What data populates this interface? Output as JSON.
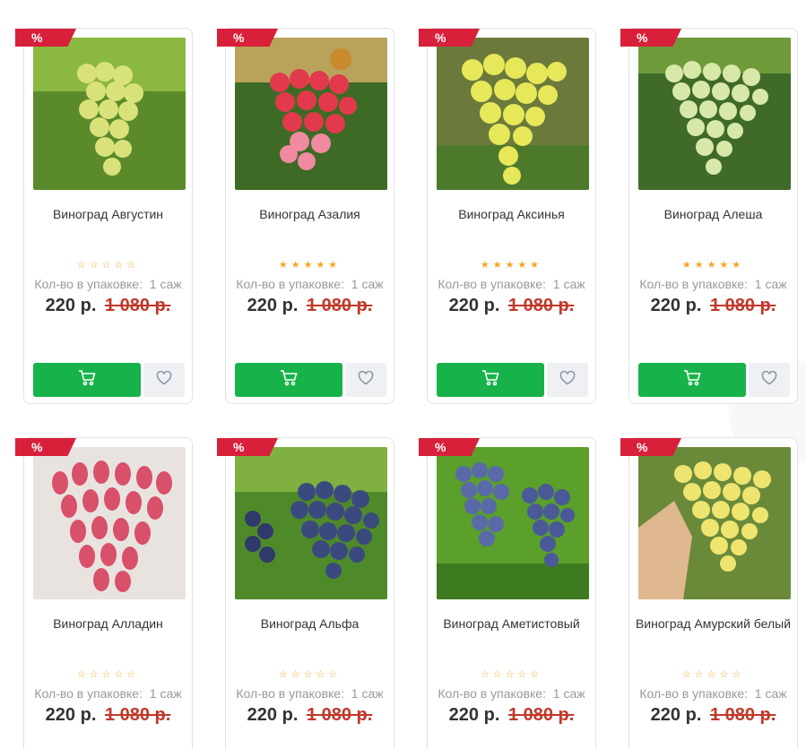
{
  "badge_label": "%",
  "qty_label": "Кол-во в упаковке:",
  "qty_value": "1 саж",
  "colors": {
    "cart": "#17b34a",
    "badge": "#d8203a",
    "old_price": "#c0392b",
    "star": "#f5a623"
  },
  "icons": {
    "cart": "cart-icon",
    "favorite": "heart-icon"
  },
  "products": [
    {
      "title": "Виноград Августин",
      "price": "220 р.",
      "old_price": "1 080 р.",
      "rating": 0,
      "stars": "☆☆☆☆☆"
    },
    {
      "title": "Виноград Азалия",
      "price": "220 р.",
      "old_price": "1 080 р.",
      "rating": 5,
      "stars": "★★★★★"
    },
    {
      "title": "Виноград Аксинья",
      "price": "220 р.",
      "old_price": "1 080 р.",
      "rating": 5,
      "stars": "★★★★★"
    },
    {
      "title": "Виноград Алеша",
      "price": "220 р.",
      "old_price": "1 080 р.",
      "rating": 5,
      "stars": "★★★★★"
    },
    {
      "title": "Виноград Алладин",
      "price": "220 р.",
      "old_price": "1 080 р.",
      "rating": 0,
      "stars": "☆☆☆☆☆"
    },
    {
      "title": "Виноград Альфа",
      "price": "220 р.",
      "old_price": "1 080 р.",
      "rating": 0,
      "stars": "☆☆☆☆☆"
    },
    {
      "title": "Виноград Аметистовый",
      "price": "220 р.",
      "old_price": "1 080 р.",
      "rating": 0,
      "stars": "☆☆☆☆☆"
    },
    {
      "title": "Виноград Амурский белый",
      "price": "220 р.",
      "old_price": "1 080 р.",
      "rating": 0,
      "stars": "☆☆☆☆☆"
    }
  ]
}
